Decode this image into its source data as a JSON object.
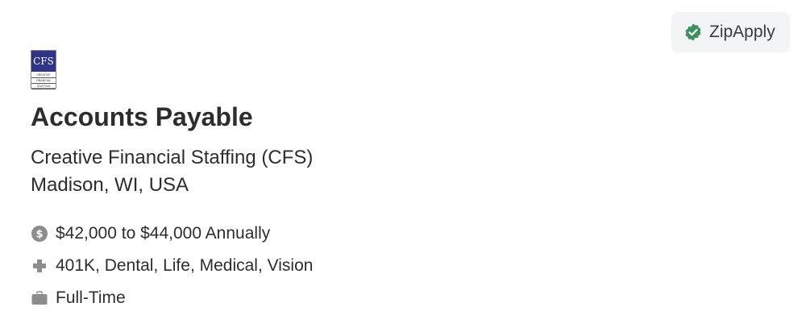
{
  "badge": {
    "label": "ZipApply",
    "icon": "verified-check-icon",
    "icon_color": "#3f8f5e"
  },
  "logo": {
    "top_text": "CFS",
    "lines": [
      "CREATIVE",
      "FINANCIAL",
      "STAFFING"
    ]
  },
  "job": {
    "title": "Accounts Payable",
    "company": "Creative Financial Staffing (CFS)",
    "location": "Madison, WI, USA"
  },
  "details": {
    "salary": "$42,000 to $44,000 Annually",
    "benefits": "401K, Dental, Life, Medical, Vision",
    "employment_type": "Full-Time"
  },
  "colors": {
    "logo_blue": "#2f3486",
    "icon_gray": "#8d8d8d",
    "text": "#2d2d2d",
    "badge_bg": "#f3f4f5"
  }
}
